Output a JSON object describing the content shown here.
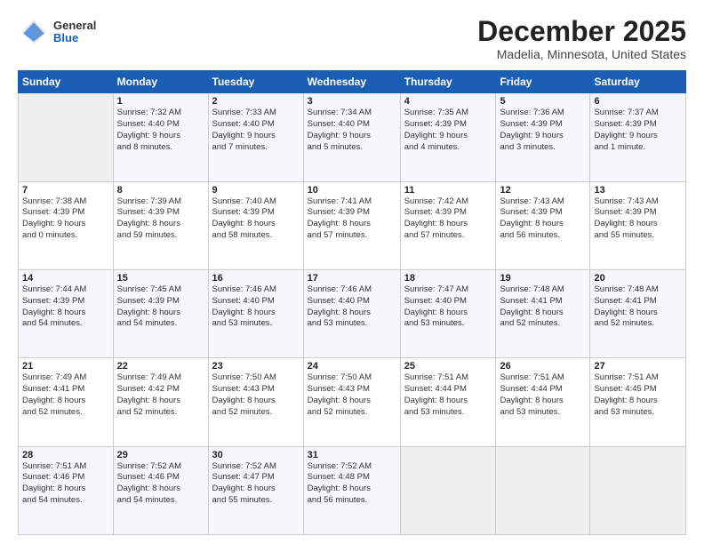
{
  "header": {
    "logo": {
      "general": "General",
      "blue": "Blue"
    },
    "title": "December 2025",
    "subtitle": "Madelia, Minnesota, United States"
  },
  "days_header": [
    "Sunday",
    "Monday",
    "Tuesday",
    "Wednesday",
    "Thursday",
    "Friday",
    "Saturday"
  ],
  "weeks": [
    [
      {
        "day": "",
        "info": ""
      },
      {
        "day": "1",
        "info": "Sunrise: 7:32 AM\nSunset: 4:40 PM\nDaylight: 9 hours\nand 8 minutes."
      },
      {
        "day": "2",
        "info": "Sunrise: 7:33 AM\nSunset: 4:40 PM\nDaylight: 9 hours\nand 7 minutes."
      },
      {
        "day": "3",
        "info": "Sunrise: 7:34 AM\nSunset: 4:40 PM\nDaylight: 9 hours\nand 5 minutes."
      },
      {
        "day": "4",
        "info": "Sunrise: 7:35 AM\nSunset: 4:39 PM\nDaylight: 9 hours\nand 4 minutes."
      },
      {
        "day": "5",
        "info": "Sunrise: 7:36 AM\nSunset: 4:39 PM\nDaylight: 9 hours\nand 3 minutes."
      },
      {
        "day": "6",
        "info": "Sunrise: 7:37 AM\nSunset: 4:39 PM\nDaylight: 9 hours\nand 1 minute."
      }
    ],
    [
      {
        "day": "7",
        "info": "Sunrise: 7:38 AM\nSunset: 4:39 PM\nDaylight: 9 hours\nand 0 minutes."
      },
      {
        "day": "8",
        "info": "Sunrise: 7:39 AM\nSunset: 4:39 PM\nDaylight: 8 hours\nand 59 minutes."
      },
      {
        "day": "9",
        "info": "Sunrise: 7:40 AM\nSunset: 4:39 PM\nDaylight: 8 hours\nand 58 minutes."
      },
      {
        "day": "10",
        "info": "Sunrise: 7:41 AM\nSunset: 4:39 PM\nDaylight: 8 hours\nand 57 minutes."
      },
      {
        "day": "11",
        "info": "Sunrise: 7:42 AM\nSunset: 4:39 PM\nDaylight: 8 hours\nand 57 minutes."
      },
      {
        "day": "12",
        "info": "Sunrise: 7:43 AM\nSunset: 4:39 PM\nDaylight: 8 hours\nand 56 minutes."
      },
      {
        "day": "13",
        "info": "Sunrise: 7:43 AM\nSunset: 4:39 PM\nDaylight: 8 hours\nand 55 minutes."
      }
    ],
    [
      {
        "day": "14",
        "info": "Sunrise: 7:44 AM\nSunset: 4:39 PM\nDaylight: 8 hours\nand 54 minutes."
      },
      {
        "day": "15",
        "info": "Sunrise: 7:45 AM\nSunset: 4:39 PM\nDaylight: 8 hours\nand 54 minutes."
      },
      {
        "day": "16",
        "info": "Sunrise: 7:46 AM\nSunset: 4:40 PM\nDaylight: 8 hours\nand 53 minutes."
      },
      {
        "day": "17",
        "info": "Sunrise: 7:46 AM\nSunset: 4:40 PM\nDaylight: 8 hours\nand 53 minutes."
      },
      {
        "day": "18",
        "info": "Sunrise: 7:47 AM\nSunset: 4:40 PM\nDaylight: 8 hours\nand 53 minutes."
      },
      {
        "day": "19",
        "info": "Sunrise: 7:48 AM\nSunset: 4:41 PM\nDaylight: 8 hours\nand 52 minutes."
      },
      {
        "day": "20",
        "info": "Sunrise: 7:48 AM\nSunset: 4:41 PM\nDaylight: 8 hours\nand 52 minutes."
      }
    ],
    [
      {
        "day": "21",
        "info": "Sunrise: 7:49 AM\nSunset: 4:41 PM\nDaylight: 8 hours\nand 52 minutes."
      },
      {
        "day": "22",
        "info": "Sunrise: 7:49 AM\nSunset: 4:42 PM\nDaylight: 8 hours\nand 52 minutes."
      },
      {
        "day": "23",
        "info": "Sunrise: 7:50 AM\nSunset: 4:43 PM\nDaylight: 8 hours\nand 52 minutes."
      },
      {
        "day": "24",
        "info": "Sunrise: 7:50 AM\nSunset: 4:43 PM\nDaylight: 8 hours\nand 52 minutes."
      },
      {
        "day": "25",
        "info": "Sunrise: 7:51 AM\nSunset: 4:44 PM\nDaylight: 8 hours\nand 53 minutes."
      },
      {
        "day": "26",
        "info": "Sunrise: 7:51 AM\nSunset: 4:44 PM\nDaylight: 8 hours\nand 53 minutes."
      },
      {
        "day": "27",
        "info": "Sunrise: 7:51 AM\nSunset: 4:45 PM\nDaylight: 8 hours\nand 53 minutes."
      }
    ],
    [
      {
        "day": "28",
        "info": "Sunrise: 7:51 AM\nSunset: 4:46 PM\nDaylight: 8 hours\nand 54 minutes."
      },
      {
        "day": "29",
        "info": "Sunrise: 7:52 AM\nSunset: 4:46 PM\nDaylight: 8 hours\nand 54 minutes."
      },
      {
        "day": "30",
        "info": "Sunrise: 7:52 AM\nSunset: 4:47 PM\nDaylight: 8 hours\nand 55 minutes."
      },
      {
        "day": "31",
        "info": "Sunrise: 7:52 AM\nSunset: 4:48 PM\nDaylight: 8 hours\nand 56 minutes."
      },
      {
        "day": "",
        "info": ""
      },
      {
        "day": "",
        "info": ""
      },
      {
        "day": "",
        "info": ""
      }
    ]
  ]
}
